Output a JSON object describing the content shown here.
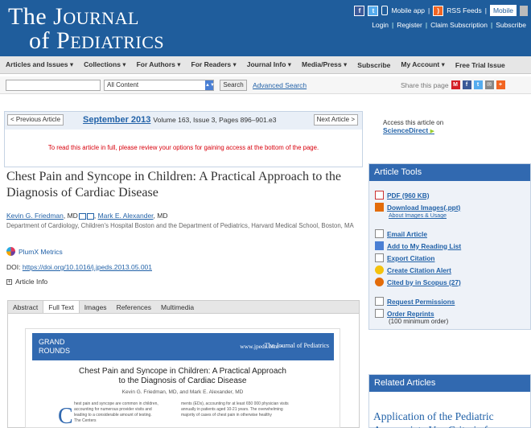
{
  "header": {
    "logo_line1_the": "The ",
    "logo_line1_big": "J",
    "logo_line1_small": "OURNAL",
    "logo_line2_of": "of ",
    "logo_line2_big": "P",
    "logo_line2_small": "EDIATRICS",
    "mobile_app": "Mobile app",
    "rss_feeds": "RSS Feeds",
    "mobile_button": "Mobile",
    "links": [
      "Login",
      "Register",
      "Claim Subscription",
      "Subscribe"
    ]
  },
  "nav": [
    "Articles and Issues ▾",
    "Collections ▾",
    "For Authors ▾",
    "For Readers ▾",
    "Journal Info ▾",
    "Media/Press ▾",
    "Subscribe",
    "My Account ▾",
    "Free Trial Issue"
  ],
  "search": {
    "scope": "All Content",
    "button": "Search",
    "advanced": "Advanced Search",
    "share_label": "Share this page"
  },
  "article_nav": {
    "prev": "< Previous Article",
    "next": "Next Article >",
    "month": "September 2013",
    "volume": "Volume 163, Issue 3, Pages 896–901.e3",
    "access_msg": "To read this article in full, please review your options for gaining access at the bottom of the page."
  },
  "access_side": {
    "text": "Access this article on",
    "link": "ScienceDirect"
  },
  "article": {
    "title": "Chest Pain and Syncope in Children: A Practical Approach to the Diagnosis of Cardiac Disease",
    "author1": "Kevin G. Friedman",
    "author1_suffix": ", MD",
    "author_sep": ", ",
    "author2": "Mark E. Alexander",
    "author2_suffix": ", MD",
    "affiliation": "Department of Cardiology, Children's Hospital Boston and the Department of Pediatrics, Harvard Medical School, Boston, MA",
    "plumx": "PlumX Metrics",
    "doi_label": "DOI: ",
    "doi_link": "https://doi.org/10.1016/j.jpeds.2013.05.001",
    "article_info": "Article Info"
  },
  "tabs": [
    "Abstract",
    "Full Text",
    "Images",
    "References",
    "Multimedia"
  ],
  "preview": {
    "band_label_1": "GRAND",
    "band_label_2": "ROUNDS",
    "url": "www.jpeds.com • ",
    "journal": "The Journal of Pediatrics",
    "title_1": "Chest Pain and Syncope in Children: A Practical Approach",
    "title_2": "to the Diagnosis of Cardiac Disease",
    "authors": "Kevin G. Friedman, MD, and Mark E. Alexander, MD",
    "dropcap": "C",
    "col1": "hest pain and syncope are common in children, accounting for numerous provider visits and leading to a considerable amount of testing. The Centers",
    "col2": "ments (EDs), accounting for at least 650 000 physician visits annually in patients aged 10-21 years. The overwhelming majority of cases of chest pain in otherwise healthy"
  },
  "tools": {
    "header": "Article Tools",
    "pdf": "PDF (960 KB)",
    "download_images": "Download Images(.ppt)",
    "about_images": "About Images & Usage",
    "email": "Email Article",
    "reading_list": "Add to My Reading List",
    "export": "Export Citation",
    "alert": "Create Citation Alert",
    "scopus": "Cited by in Scopus (27)",
    "permissions": "Request Permissions",
    "reprints": "Order Reprints",
    "reprints_note": "(100 minimum order)"
  },
  "related": {
    "header": "Related Articles",
    "item": "Application of the Pediatric Appropriate Use Criteria for"
  }
}
